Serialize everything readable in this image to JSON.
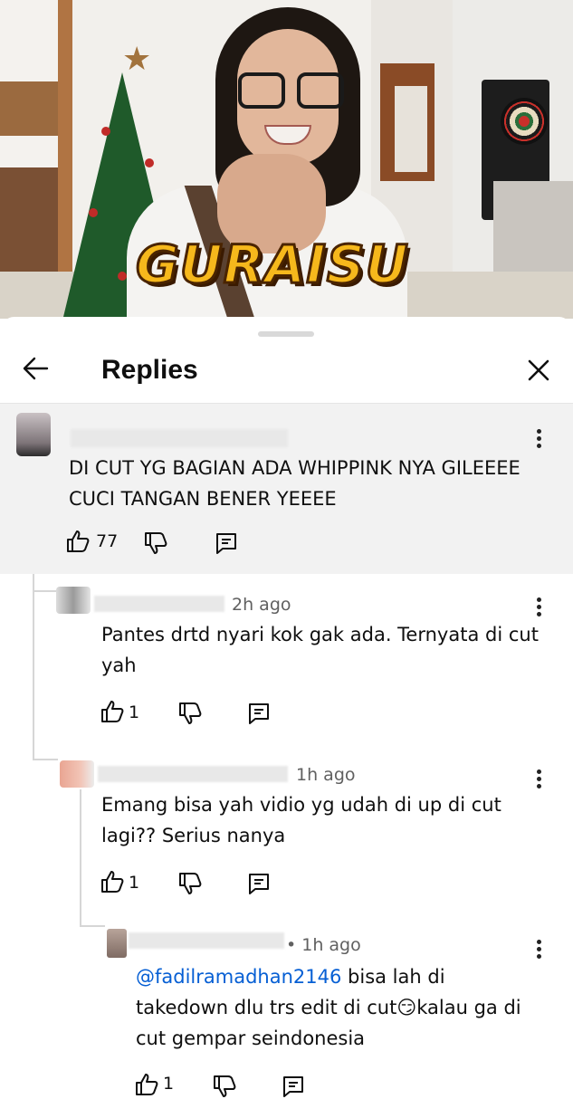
{
  "video": {
    "logo_text": "GURAISU"
  },
  "sheet": {
    "title": "Replies"
  },
  "comments": [
    {
      "time": "",
      "text": "DI CUT YG BAGIAN ADA WHIPPINK NYA GILEEEE CUCI TANGAN BENER YEEEE",
      "likes": "77"
    },
    {
      "time": "2h ago",
      "text": "Pantes drtd nyari kok gak ada. Ternyata di cut yah",
      "likes": "1"
    },
    {
      "time": "1h ago",
      "text": "Emang bisa yah vidio yg udah di up di cut lagi?? Serius nanya",
      "likes": "1"
    },
    {
      "time": "• 1h ago",
      "mention": "@fadilramadhan2146",
      "text": " bisa lah di takedown dlu trs edit di cut😏kalau ga di cut gempar seindonesia",
      "likes": "1"
    }
  ],
  "icons": {
    "back": "arrow-left-icon",
    "close": "close-icon",
    "like": "thumbs-up-icon",
    "dislike": "thumbs-down-icon",
    "reply": "reply-comment-icon",
    "more": "more-vert-icon"
  },
  "colors": {
    "mention": "#065fd4",
    "parent_bg": "#f2f2f2",
    "logo": "#f6b81c"
  }
}
